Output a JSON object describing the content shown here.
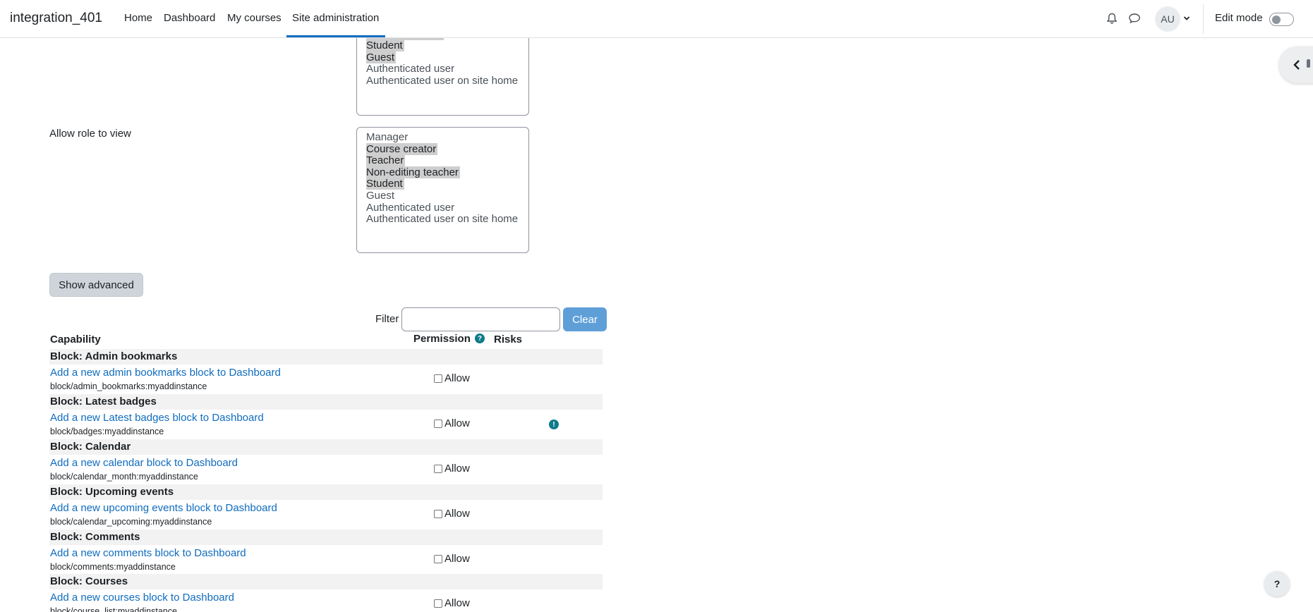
{
  "navbar": {
    "brand": "integration_401",
    "items": [
      "Home",
      "Dashboard",
      "My courses",
      "Site administration"
    ],
    "active_item": "Site administration",
    "user_initials": "AU",
    "edit_mode_label": "Edit mode",
    "edit_mode_on": false,
    "accent_color": "#0f6cbf"
  },
  "icons": [
    "bell-icon",
    "chat-icon",
    "chevron-down-icon",
    "chevron-left-icon",
    "help-icon",
    "risk-icon"
  ],
  "roles_box_top": {
    "options": [
      {
        "label": "Student",
        "selected": true
      },
      {
        "label": "Guest",
        "selected": true
      },
      {
        "label": "Authenticated user",
        "selected": false
      },
      {
        "label": "Authenticated user on site home",
        "selected": false
      }
    ]
  },
  "allow_view": {
    "label": "Allow role to view",
    "options": [
      {
        "label": "Manager",
        "selected": false
      },
      {
        "label": "Course creator",
        "selected": true
      },
      {
        "label": "Teacher",
        "selected": true
      },
      {
        "label": "Non-editing teacher",
        "selected": true
      },
      {
        "label": "Student",
        "selected": true
      },
      {
        "label": "Guest",
        "selected": false
      },
      {
        "label": "Authenticated user",
        "selected": false
      },
      {
        "label": "Authenticated user on site home",
        "selected": false
      }
    ]
  },
  "show_advanced_label": "Show advanced",
  "filter": {
    "label": "Filter",
    "value": "",
    "clear_label": "Clear"
  },
  "table": {
    "headers": {
      "capability": "Capability",
      "permission": "Permission",
      "risks": "Risks"
    },
    "allow_label": "Allow",
    "groups": [
      {
        "title": "Block: Admin bookmarks",
        "link": "Add a new admin bookmarks block to Dashboard",
        "capability": "block/admin_bookmarks:myaddinstance",
        "allowed": false,
        "risk": false
      },
      {
        "title": "Block: Latest badges",
        "link": "Add a new Latest badges block to Dashboard",
        "capability": "block/badges:myaddinstance",
        "allowed": false,
        "risk": true
      },
      {
        "title": "Block: Calendar",
        "link": "Add a new calendar block to Dashboard",
        "capability": "block/calendar_month:myaddinstance",
        "allowed": false,
        "risk": false
      },
      {
        "title": "Block: Upcoming events",
        "link": "Add a new upcoming events block to Dashboard",
        "capability": "block/calendar_upcoming:myaddinstance",
        "allowed": false,
        "risk": false
      },
      {
        "title": "Block: Comments",
        "link": "Add a new comments block to Dashboard",
        "capability": "block/comments:myaddinstance",
        "allowed": false,
        "risk": false
      },
      {
        "title": "Block: Courses",
        "link": "Add a new courses block to Dashboard",
        "capability": "block/course_list:myaddinstance",
        "allowed": false,
        "risk": false
      }
    ]
  }
}
